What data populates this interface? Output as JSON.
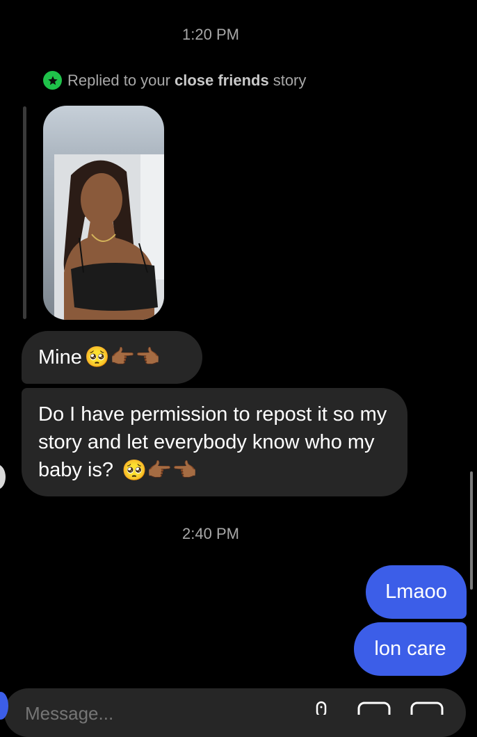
{
  "timestamps": [
    "1:20 PM",
    "2:40 PM"
  ],
  "reply_note": {
    "prefix": "Replied to your",
    "bold": "close friends",
    "suffix": "story"
  },
  "messages_received": [
    {
      "text": "Mine",
      "emojis": "🥺👉🏾👈🏾"
    },
    {
      "text": "Do I have permission to repost it so my story and let everybody know who my baby is?",
      "emojis": "🥺👉🏾👈🏾"
    }
  ],
  "messages_sent": [
    "Lmaoo",
    "lon care"
  ],
  "composer": {
    "placeholder": "Message..."
  },
  "colors": {
    "sent_bubble": "#3c5ee8",
    "received_bubble": "#262626",
    "close_friends_badge": "#1fc24a",
    "background": "#000000"
  }
}
